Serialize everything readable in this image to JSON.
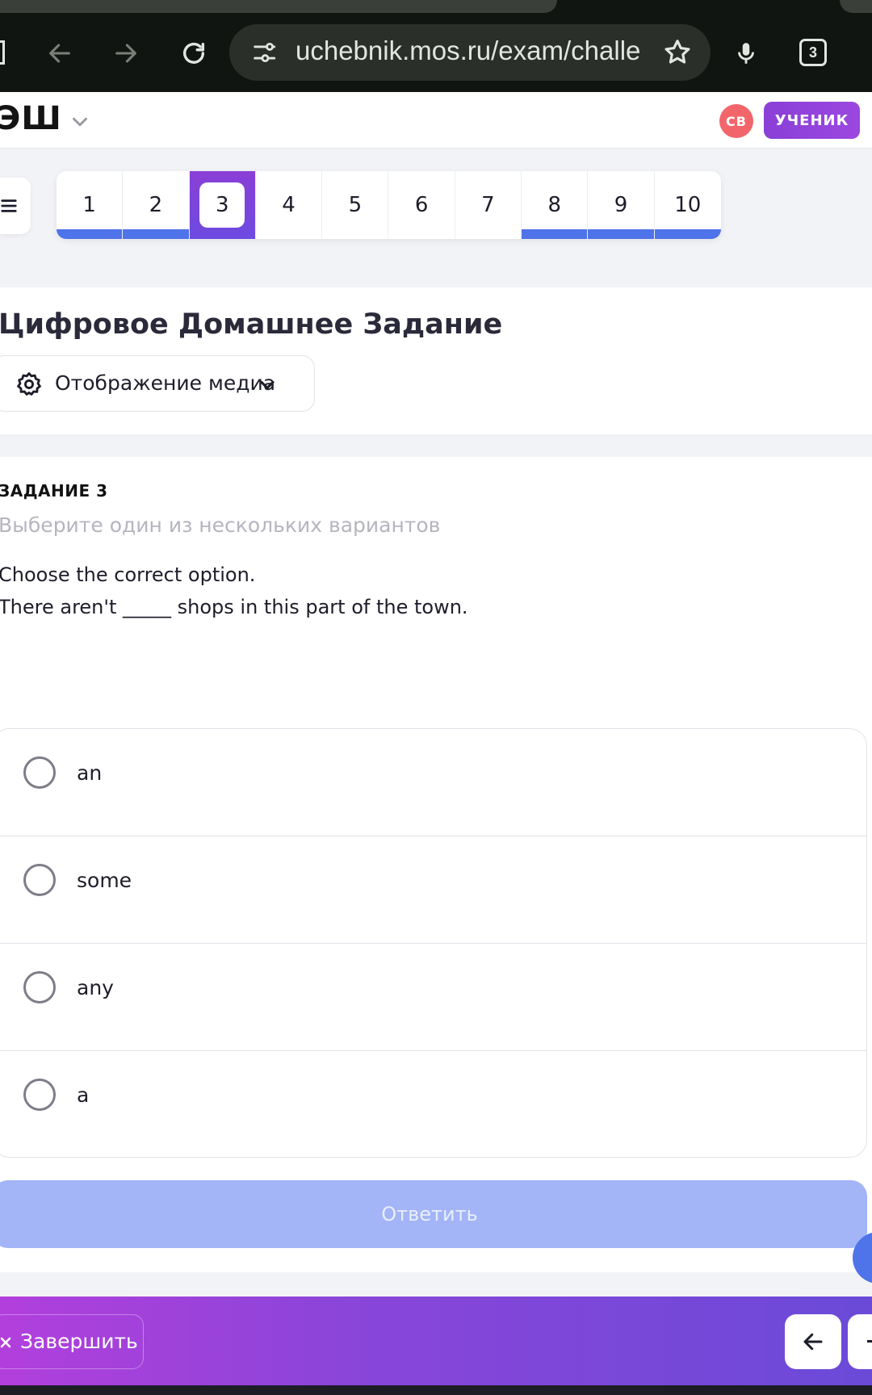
{
  "browser": {
    "url": "uchebnik.mos.ru/exam/challe",
    "tab_count": "3"
  },
  "header": {
    "logo": "ЭШ",
    "avatar_initials": "СВ",
    "role": "УЧЕНИК"
  },
  "question_nav": {
    "items": [
      {
        "number": "1",
        "state": "answered"
      },
      {
        "number": "2",
        "state": "answered"
      },
      {
        "number": "3",
        "state": "current"
      },
      {
        "number": "4",
        "state": "unanswered"
      },
      {
        "number": "5",
        "state": "unanswered"
      },
      {
        "number": "6",
        "state": "unanswered"
      },
      {
        "number": "7",
        "state": "unanswered"
      },
      {
        "number": "8",
        "state": "answered"
      },
      {
        "number": "9",
        "state": "answered"
      },
      {
        "number": "10",
        "state": "answered"
      }
    ]
  },
  "title_card": {
    "title": "Цифровое Домашнее Задание",
    "media_button": "Отображение медиа"
  },
  "task": {
    "label": "ЗАДАНИЕ 3",
    "hint": "Выберите один из нескольких вариантов",
    "instruction": "Choose the correct option.",
    "sentence": "There aren't _____ shops in this part of the town.",
    "options": [
      {
        "label": "an"
      },
      {
        "label": "some"
      },
      {
        "label": "any"
      },
      {
        "label": "a"
      }
    ],
    "submit_label": "Ответить"
  },
  "bottom_bar": {
    "finish_label": "Завершить"
  },
  "colors": {
    "accent_purple": "#8a3fd6",
    "answered_blue": "#4f73e8",
    "submit_disabled": "#a3b4f7",
    "avatar_red": "#f2666b"
  },
  "icons": [
    "back-icon",
    "forward-icon",
    "reload-icon",
    "site-settings-icon",
    "star-icon",
    "mic-icon",
    "tab-count-icon",
    "chevron-down-icon",
    "menu-icon",
    "gear-icon",
    "close-icon",
    "arrow-left-icon"
  ]
}
